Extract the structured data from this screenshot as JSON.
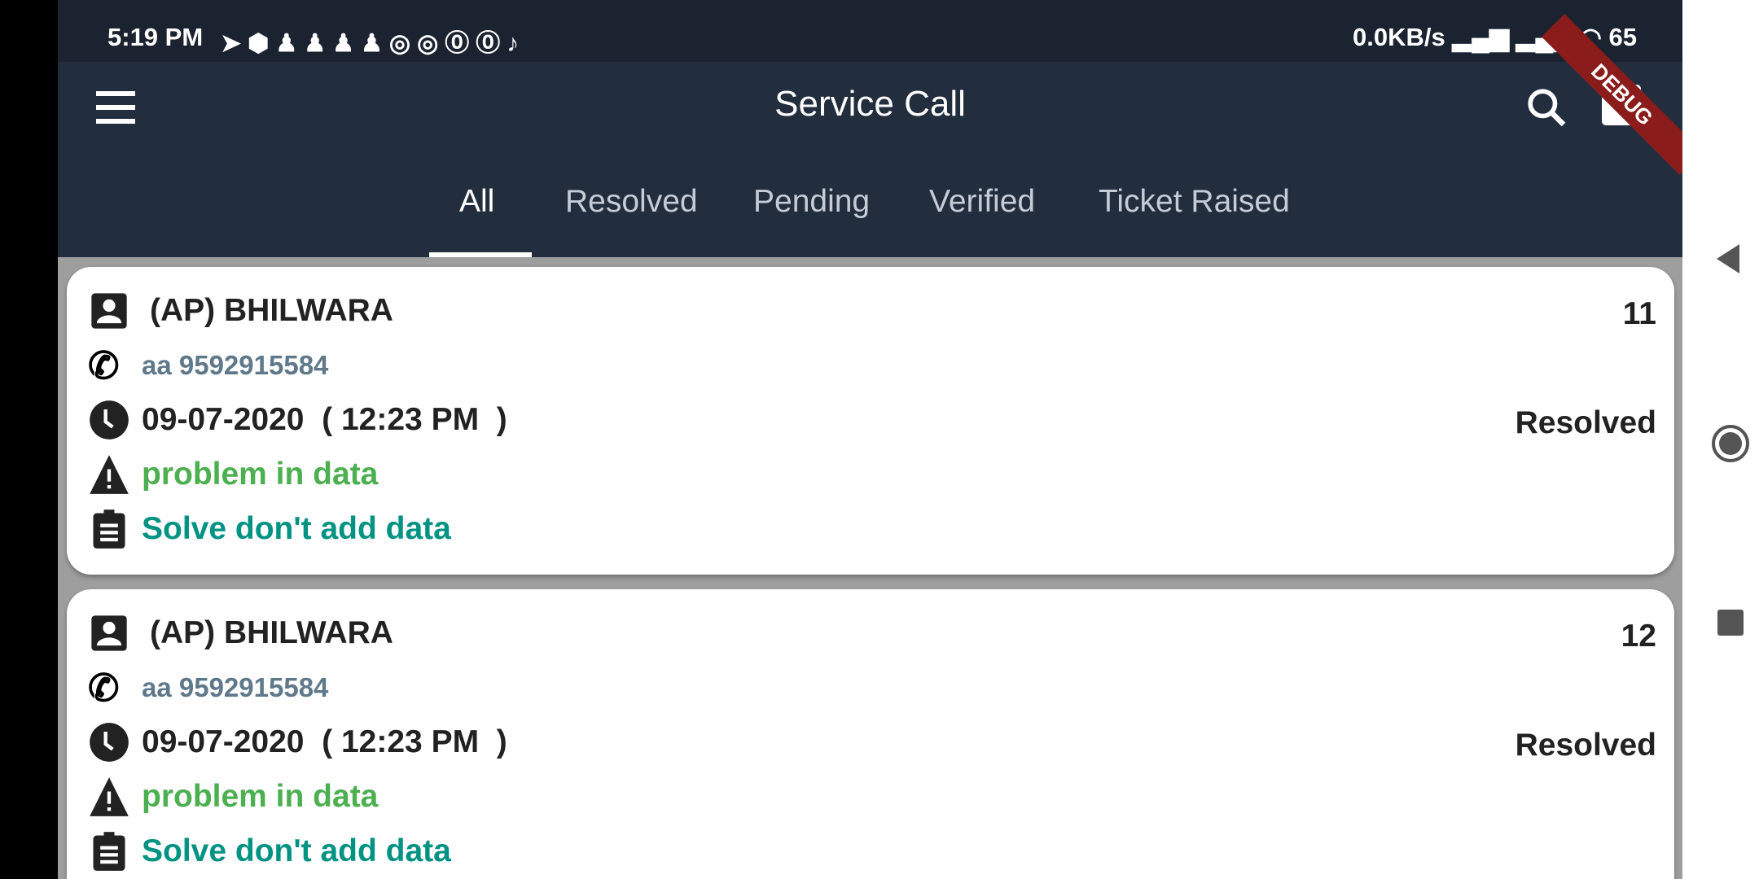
{
  "status_bar": {
    "time": "5:19 PM",
    "notification_icons": [
      "telegram-icon",
      "mpl-icon",
      "snapchat-icon",
      "snapchat-icon",
      "snapchat-icon",
      "snapchat-icon",
      "instagram-icon",
      "instagram-icon",
      "threads-icon",
      "threads-icon",
      "tiktok-icon"
    ],
    "net_speed": "0.0KB/s",
    "battery": "65"
  },
  "app_bar": {
    "title": "Service Call",
    "debug_banner": "DEBUG"
  },
  "tabs": [
    {
      "label": "All",
      "active": true
    },
    {
      "label": "Resolved"
    },
    {
      "label": "Pending"
    },
    {
      "label": "Verified"
    },
    {
      "label": "Ticket Raised"
    }
  ],
  "calls": [
    {
      "name": "(AP) BHILWARA",
      "id": "11",
      "phone": "aa 9592915584",
      "datetime": "09-07-2020  ( 12:23 PM  )",
      "status": "Resolved",
      "problem": "problem in data",
      "solution": "Solve don't add data"
    },
    {
      "name": "(AP) BHILWARA",
      "id": "12",
      "phone": "aa 9592915584",
      "datetime": "09-07-2020  ( 12:23 PM  )",
      "status": "Resolved",
      "problem": "problem in data",
      "solution": "Solve don't add data"
    }
  ],
  "colors": {
    "appbar": "#222d3e",
    "problem": "#4caf50",
    "solution": "#009282",
    "phone": "#60798a"
  }
}
